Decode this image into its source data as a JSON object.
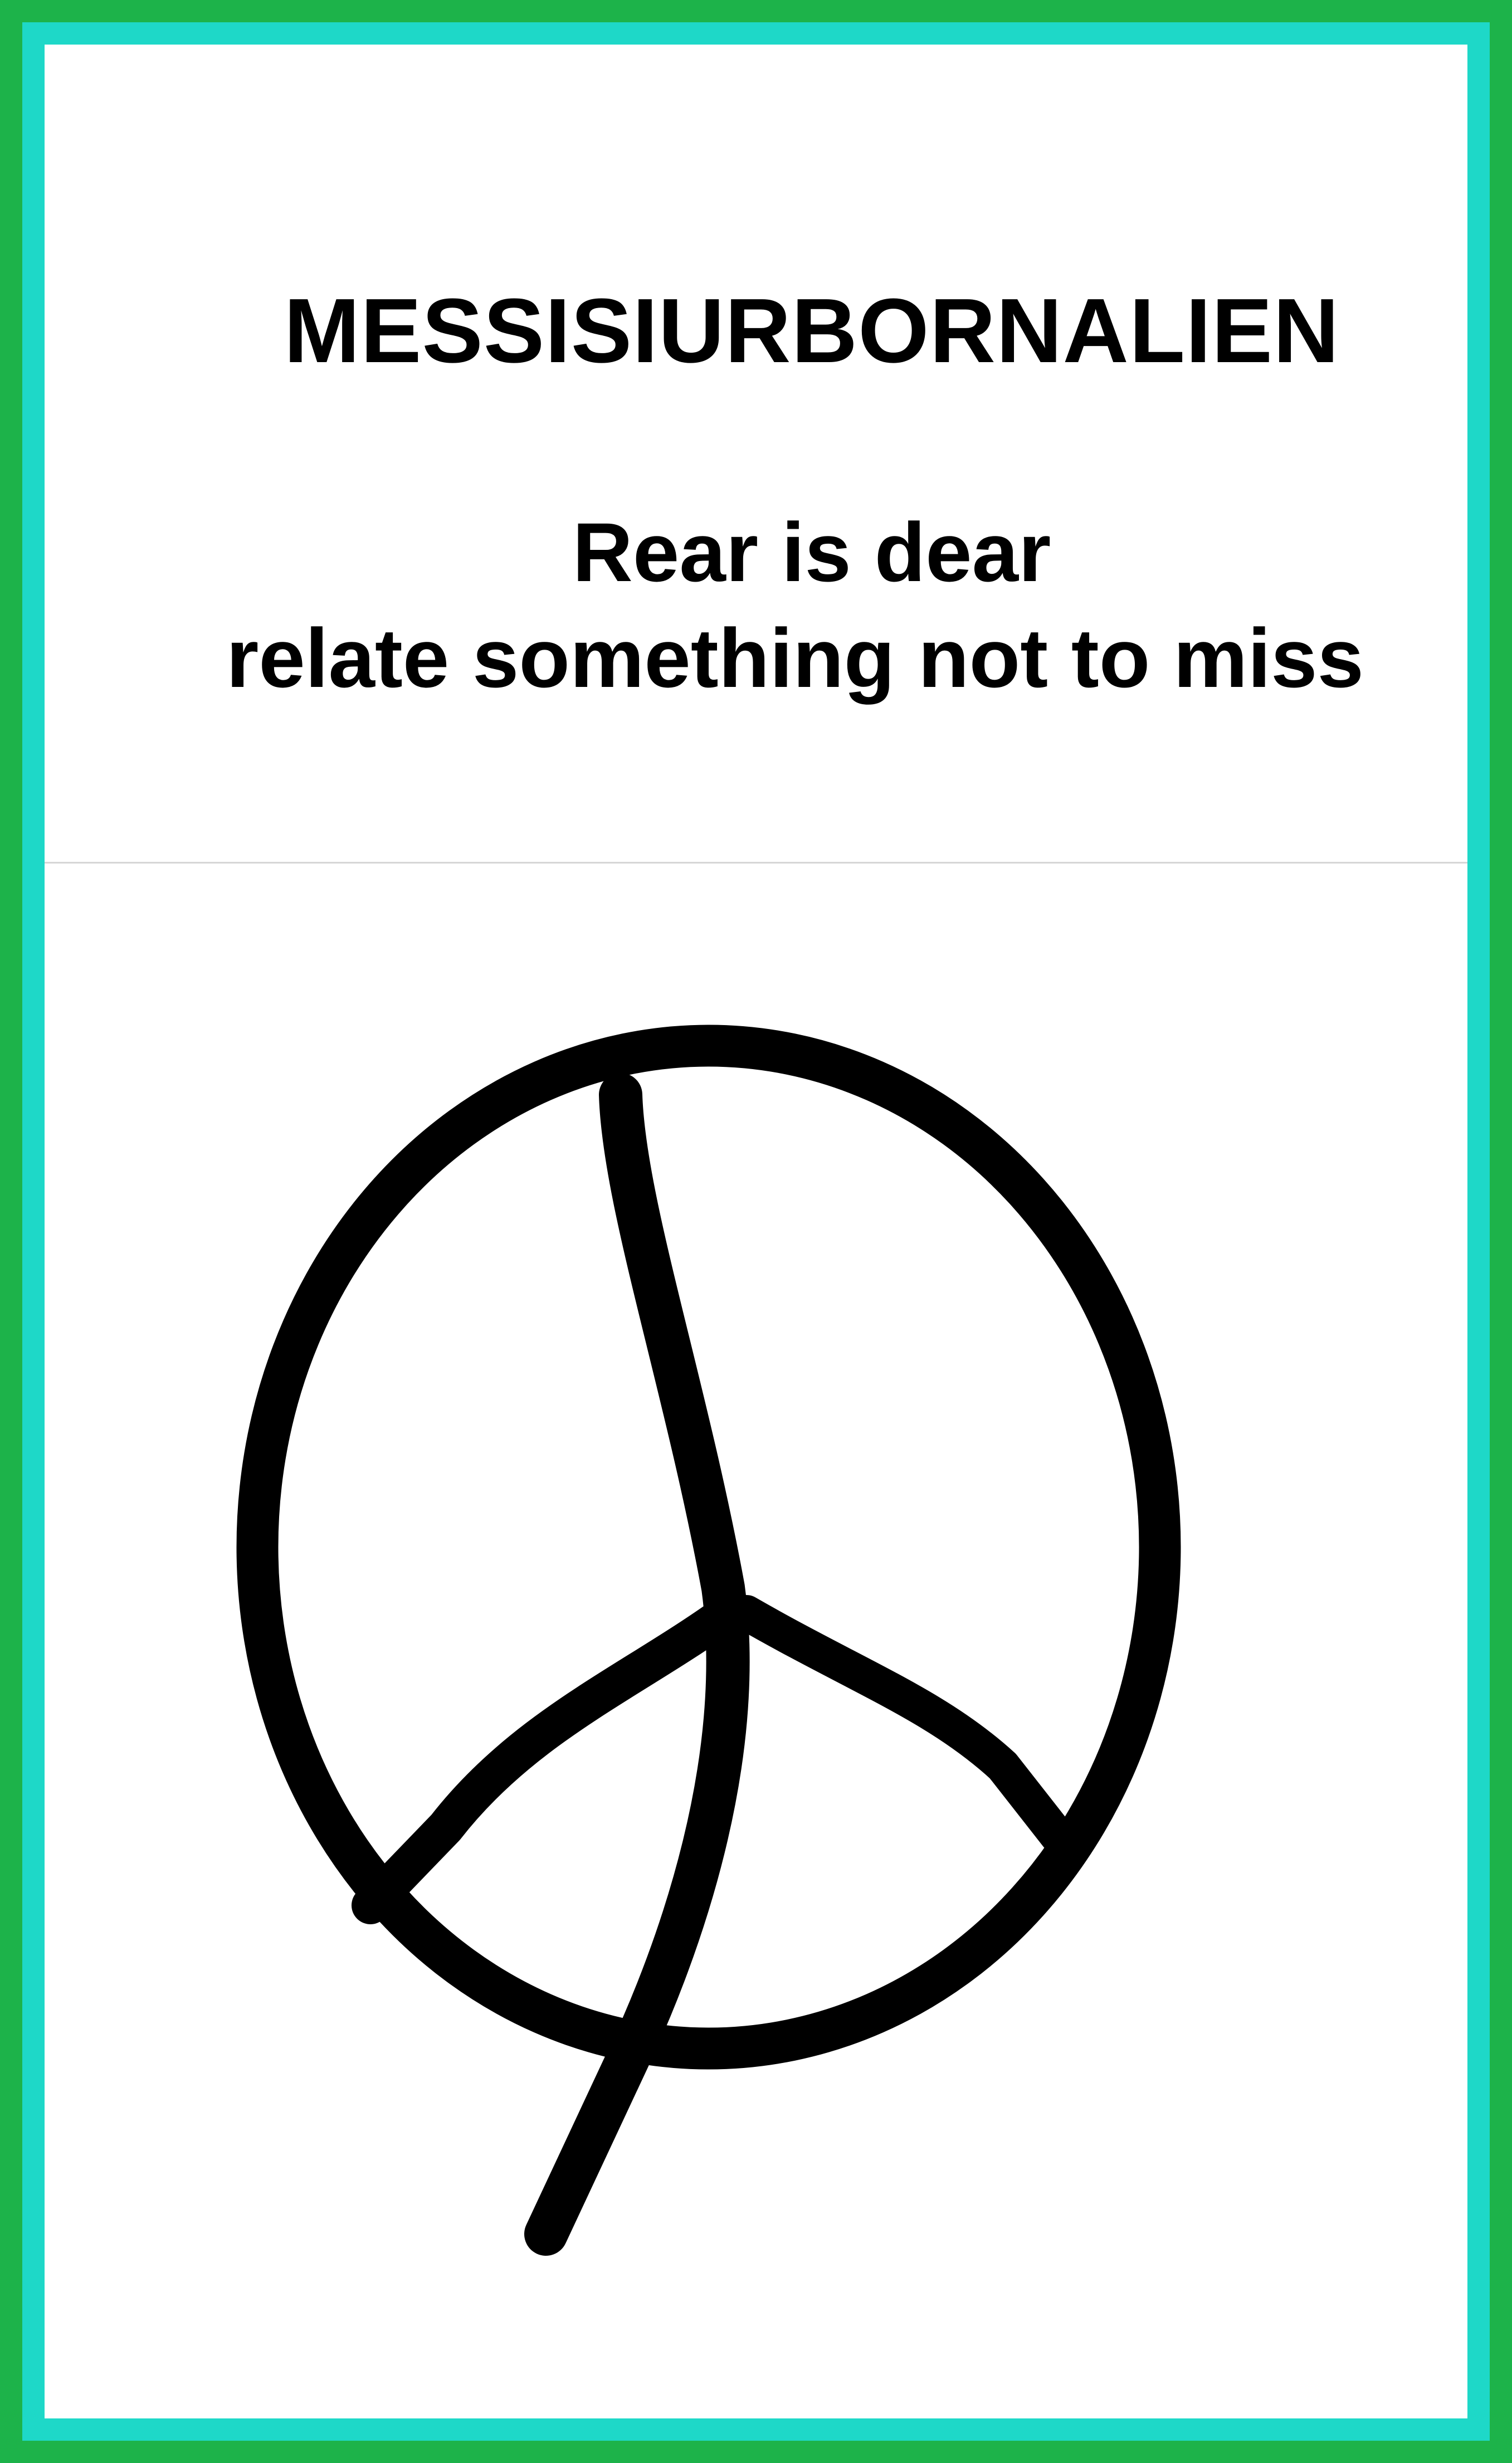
{
  "frame": {
    "outer_color": "#1db34a",
    "inner_color": "#1ed8c8",
    "background": "#ffffff"
  },
  "header": {
    "title": "MESSISIURBORNALIEN",
    "line1": "Rear is dear",
    "line2": "relate something not to miss"
  },
  "illustration": {
    "icon": "peace-symbol-icon",
    "stroke_color": "#000000"
  }
}
